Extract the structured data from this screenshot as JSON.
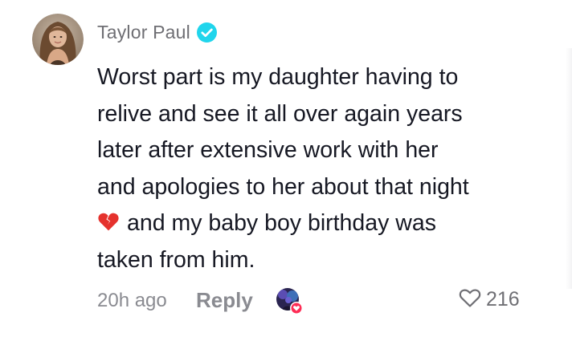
{
  "comment": {
    "author": {
      "name": "Taylor Paul",
      "verified": true,
      "avatar_icon": "user-avatar"
    },
    "text_lines": [
      "Worst part is my daughter having to",
      "relive and see it all over again years",
      "later after extensive work with her",
      "and apologies to her about that night",
      "and my baby boy birthday was",
      "taken from him."
    ],
    "emoji_icon": "broken-heart-icon",
    "footer": {
      "time": "20h ago",
      "reply_label": "Reply",
      "like_count": "216",
      "like_icon": "heart-outline-icon",
      "creator_liked_icon": "creator-liked-avatar-icon"
    },
    "colors": {
      "verified": "#20d5ec",
      "text": "#161823",
      "muted": "#8a8b91",
      "broken_heart": "#e5322d",
      "liked_badge": "#fe2c55"
    }
  }
}
